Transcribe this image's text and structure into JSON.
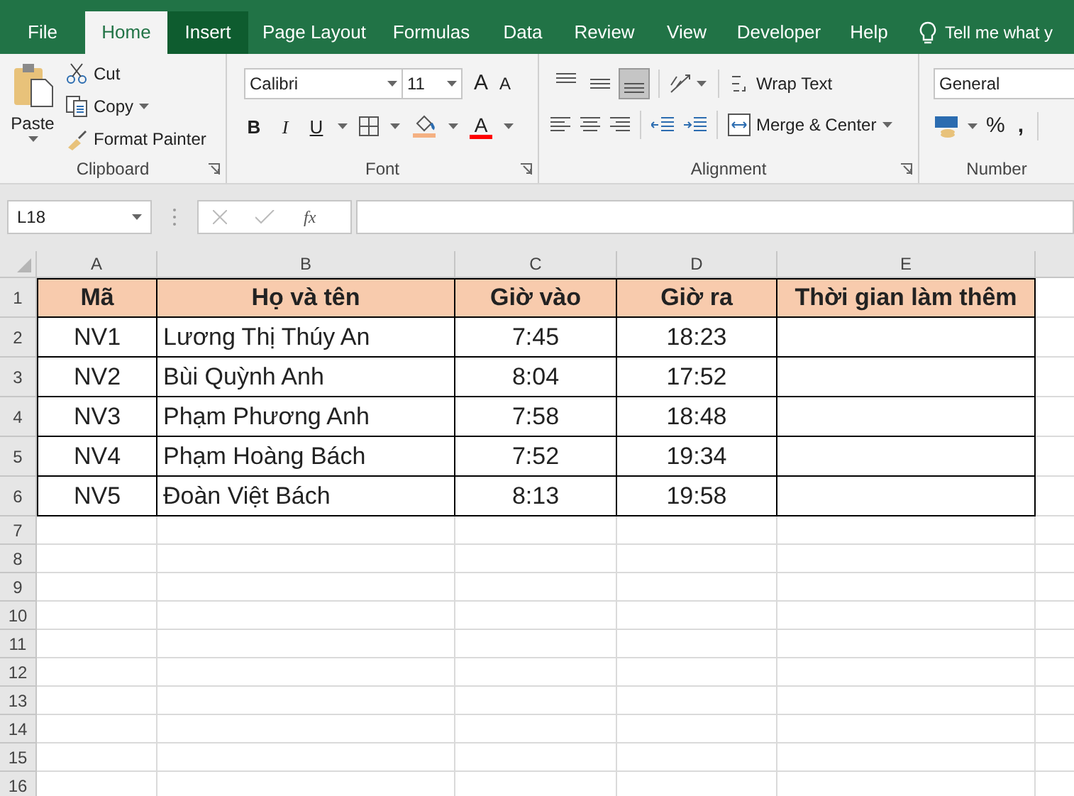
{
  "tabs": [
    {
      "label": "File",
      "selected": false,
      "hovered": false
    },
    {
      "label": "Home",
      "selected": true,
      "hovered": false
    },
    {
      "label": "Insert",
      "selected": false,
      "hovered": true
    },
    {
      "label": "Page Layout",
      "selected": false,
      "hovered": false
    },
    {
      "label": "Formulas",
      "selected": false,
      "hovered": false
    },
    {
      "label": "Data",
      "selected": false,
      "hovered": false
    },
    {
      "label": "Review",
      "selected": false,
      "hovered": false
    },
    {
      "label": "View",
      "selected": false,
      "hovered": false
    },
    {
      "label": "Developer",
      "selected": false,
      "hovered": false
    },
    {
      "label": "Help",
      "selected": false,
      "hovered": false
    }
  ],
  "tell_me": "Tell me what y",
  "clipboard": {
    "label": "Clipboard",
    "paste": "Paste",
    "cut": "Cut",
    "copy": "Copy",
    "format_painter": "Format Painter"
  },
  "font": {
    "label": "Font",
    "family": "Calibri",
    "size": "11",
    "grow": "A",
    "shrink": "A",
    "bold": "B",
    "italic": "I",
    "underline": "U",
    "font_color": "A"
  },
  "alignment": {
    "label": "Alignment",
    "vertical": [
      {
        "kind": "top",
        "selected": false
      },
      {
        "kind": "middle",
        "selected": false
      },
      {
        "kind": "bottom",
        "selected": true
      }
    ],
    "wrap_text": "Wrap Text",
    "merge_center": "Merge & Center"
  },
  "number": {
    "label": "Number",
    "format": "General",
    "percent": "%",
    "comma": ","
  },
  "name_box": "L18",
  "fx": "fx",
  "columns": [
    "A",
    "B",
    "C",
    "D",
    "E"
  ],
  "rows": [
    {
      "number": "1",
      "kind": "header",
      "cells": [
        "Mã",
        "Họ và tên",
        "Giờ vào",
        "Giờ ra",
        "Thời gian làm thêm"
      ]
    },
    {
      "number": "2",
      "kind": "data",
      "cells": [
        "NV1",
        "Lương Thị Thúy An",
        "7:45",
        "18:23",
        ""
      ]
    },
    {
      "number": "3",
      "kind": "data",
      "cells": [
        "NV2",
        "Bùi Quỳnh Anh",
        "8:04",
        "17:52",
        ""
      ]
    },
    {
      "number": "4",
      "kind": "data",
      "cells": [
        "NV3",
        "Phạm Phương Anh",
        "7:58",
        "18:48",
        ""
      ]
    },
    {
      "number": "5",
      "kind": "data",
      "cells": [
        "NV4",
        "Phạm Hoàng Bách",
        "7:52",
        "19:34",
        ""
      ]
    },
    {
      "number": "6",
      "kind": "data",
      "cells": [
        "NV5",
        "Đoàn Việt Bách",
        "8:13",
        "19:58",
        ""
      ]
    },
    {
      "number": "7",
      "kind": "empty"
    },
    {
      "number": "8",
      "kind": "empty"
    },
    {
      "number": "9",
      "kind": "empty"
    },
    {
      "number": "10",
      "kind": "empty"
    },
    {
      "number": "11",
      "kind": "empty"
    },
    {
      "number": "12",
      "kind": "empty"
    },
    {
      "number": "13",
      "kind": "empty"
    },
    {
      "number": "14",
      "kind": "empty"
    },
    {
      "number": "15",
      "kind": "empty"
    },
    {
      "number": "16",
      "kind": "empty"
    }
  ]
}
